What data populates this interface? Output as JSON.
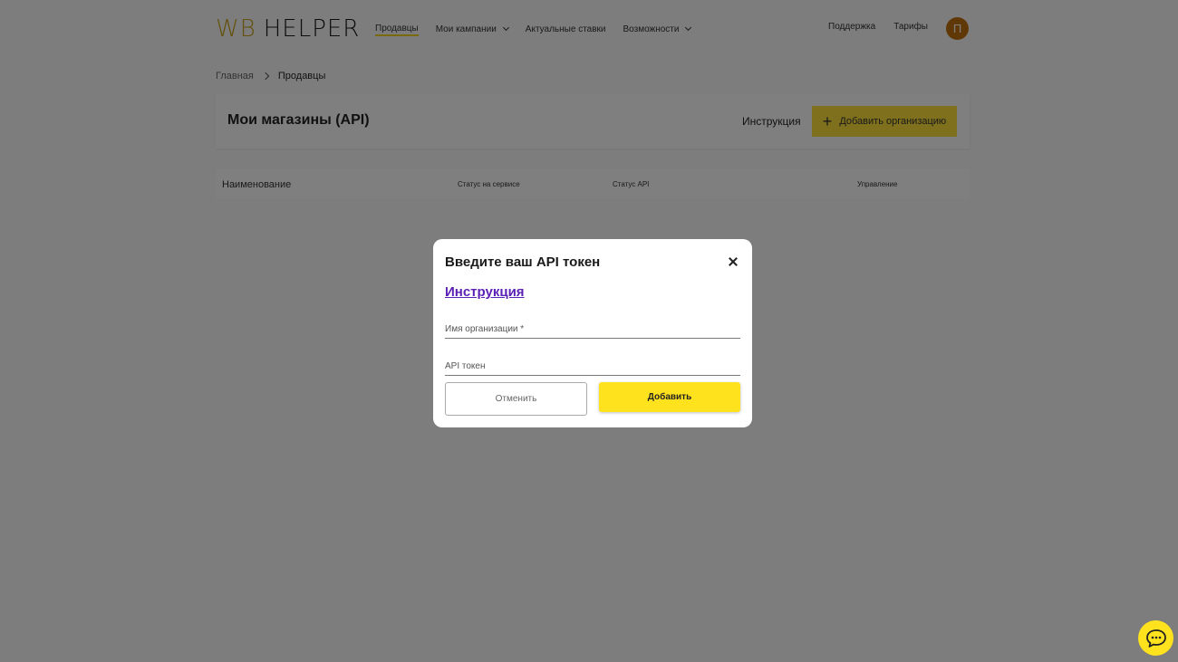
{
  "header": {
    "logo_wb": "WB",
    "logo_helper": "HELPER",
    "nav": [
      {
        "label": "Продавцы"
      },
      {
        "label": "Мои кампании"
      },
      {
        "label": "Актуальные ставки"
      },
      {
        "label": "Возможности"
      }
    ],
    "support": "Поддержка",
    "tariffs": "Тарифы",
    "avatar_letter": "П"
  },
  "breadcrumb": {
    "home": "Главная",
    "current": "Продавцы"
  },
  "page": {
    "title": "Мои магазины (API)",
    "instruction_link": "Инструкция",
    "add_org_button": "Добавить организацию"
  },
  "table": {
    "columns": [
      "Наименование",
      "Статус на сервисе",
      "Статус API",
      "Управление"
    ]
  },
  "modal": {
    "title": "Введите ваш API токен",
    "instruction_link": "Инструкция",
    "org_name_placeholder": "Имя организации *",
    "api_token_placeholder": "API токен",
    "cancel_button": "Отменить",
    "add_button": "Добавить"
  },
  "colors": {
    "accent": "#ffe21e",
    "logo_gold": "#c9a21a",
    "avatar": "#c0710a",
    "link_purple": "#5b21b6"
  },
  "icons": {
    "close": "close-icon",
    "chat": "chat-bubble-icon",
    "plus": "plus-icon"
  }
}
